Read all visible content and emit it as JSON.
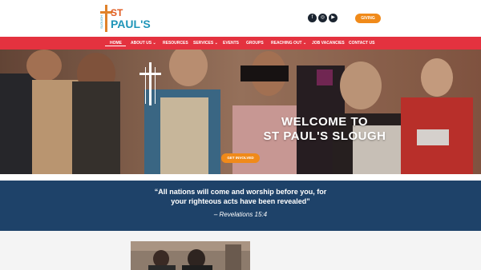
{
  "header": {
    "logo": {
      "line1": "ST",
      "line2": "PAUL'S",
      "small": "SLOUGH"
    },
    "social": [
      {
        "name": "facebook-icon",
        "glyph": "f"
      },
      {
        "name": "instagram-icon",
        "glyph": "◎"
      },
      {
        "name": "youtube-icon",
        "glyph": "▶"
      }
    ],
    "giving_label": "GIVING"
  },
  "nav": {
    "items": [
      "HOME",
      "ABOUT US ⌄",
      "RESOURCES",
      "SERVICES ⌄",
      "EVENTS",
      "GROUPS",
      "REACHING OUT ⌄",
      "JOB VACANCIES",
      "CONTACT US"
    ],
    "active": "HOME"
  },
  "hero": {
    "title_line1": "WELCOME TO",
    "title_line2": "ST PAUL'S SLOUGH",
    "cta_label": "GET INVOLVED"
  },
  "quote": {
    "line1": "“All nations will come and worship before you, for",
    "line2": "your righteous acts have been revealed”",
    "reference": "– Revelations 15:4"
  },
  "colors": {
    "nav_red": "#e4323f",
    "accent_orange": "#f08a1a",
    "quote_navy": "#1e4269",
    "logo_blue": "#1f95b8"
  }
}
